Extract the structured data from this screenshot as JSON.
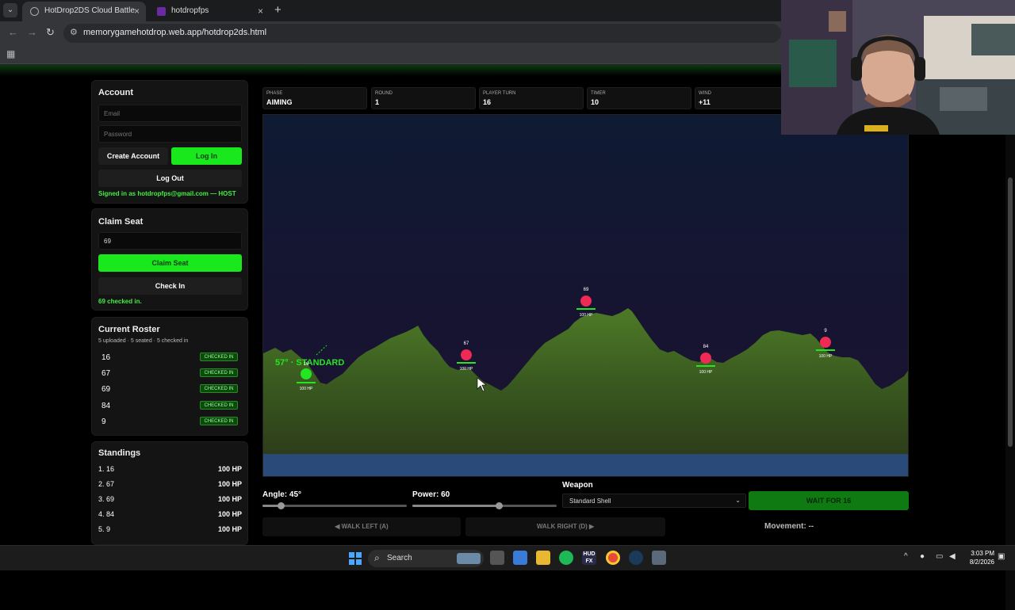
{
  "browser": {
    "tab1_title": "HotDrop2DS Cloud Battle",
    "tab2_title": "hotdropfps",
    "url": "memorygamehotdrop.web.app/hotdrop2ds.html"
  },
  "account": {
    "title": "Account",
    "email_placeholder": "Email",
    "password_placeholder": "Password",
    "create_label": "Create Account",
    "login_label": "Log In",
    "logout_label": "Log Out",
    "status": "Signed in as hotdropfps@gmail.com — HOST"
  },
  "claim": {
    "title": "Claim Seat",
    "seat_value": "69",
    "claim_label": "Claim Seat",
    "checkin_label": "Check In",
    "status": "69 checked in."
  },
  "roster": {
    "title": "Current Roster",
    "summary": "5 uploaded · 5 seated · 5 checked in",
    "items": [
      {
        "num": "16",
        "status": "CHECKED IN"
      },
      {
        "num": "67",
        "status": "CHECKED IN"
      },
      {
        "num": "69",
        "status": "CHECKED IN"
      },
      {
        "num": "84",
        "status": "CHECKED IN"
      },
      {
        "num": "9",
        "status": "CHECKED IN"
      }
    ]
  },
  "standings": {
    "title": "Standings",
    "items": [
      {
        "name": "1. 16",
        "hp": "100 HP"
      },
      {
        "name": "2. 67",
        "hp": "100 HP"
      },
      {
        "name": "3. 69",
        "hp": "100 HP"
      },
      {
        "name": "4. 84",
        "hp": "100 HP"
      },
      {
        "name": "5. 9",
        "hp": "100 HP"
      }
    ]
  },
  "stats": [
    {
      "label": "PHASE",
      "value": "AIMING"
    },
    {
      "label": "ROUND",
      "value": "1"
    },
    {
      "label": "PLAYER TURN",
      "value": "16"
    },
    {
      "label": "TIMER",
      "value": "10"
    },
    {
      "label": "WIND",
      "value": "+11"
    }
  ],
  "battlefield": {
    "aim_text": "57° · STANDARD",
    "players": [
      {
        "id": "16",
        "hp": "100 HP",
        "color": "#22e622"
      },
      {
        "id": "67",
        "hp": "100 HP",
        "color": "#ee2a55"
      },
      {
        "id": "69",
        "hp": "100 HP",
        "color": "#ee2a55"
      },
      {
        "id": "84",
        "hp": "100 HP",
        "color": "#ee2a55"
      },
      {
        "id": "9",
        "hp": "100 HP",
        "color": "#ee2a55"
      }
    ]
  },
  "controls": {
    "angle_label": "Angle: 45°",
    "angle_value": 45,
    "power_label": "Power: 60",
    "power_value": 60,
    "weapon_label": "Weapon",
    "weapon_value": "Standard Shell",
    "wait_label": "WAIT FOR 16",
    "walk_left": "◀ WALK LEFT (A)",
    "walk_right": "WALK RIGHT (D) ▶",
    "movement": "Movement: --"
  },
  "taskbar": {
    "search": "Search",
    "time": "3:03 PM",
    "date": "8/2/2026"
  },
  "colors": {
    "accent": "#18e81c",
    "enemy": "#ee2a55",
    "water": "#2a4a7a"
  }
}
